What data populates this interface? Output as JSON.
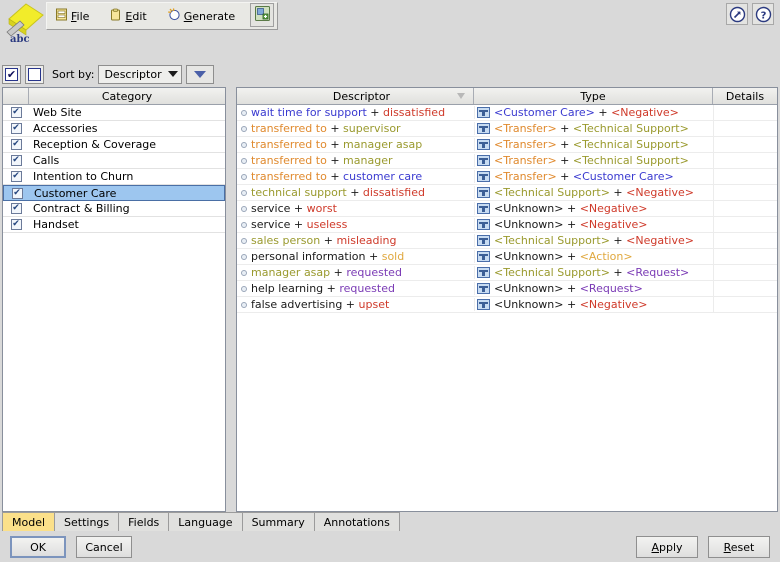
{
  "app": {
    "logo_text": "abc"
  },
  "menu": {
    "items": [
      {
        "label": "File",
        "mnemonic": "F",
        "icon": "file-cabinet-icon"
      },
      {
        "label": "Edit",
        "mnemonic": "E",
        "icon": "clipboard-icon"
      },
      {
        "label": "Generate",
        "mnemonic": "G",
        "icon": "magic-wand-icon"
      }
    ],
    "generate_button_icon": "generate-grid-icon"
  },
  "window_buttons": [
    {
      "name": "expand-button",
      "icon": "arrow-up-right-icon"
    },
    {
      "name": "help-button",
      "icon": "question-mark-icon"
    }
  ],
  "sortbar": {
    "check_all_label": "✔",
    "uncheck_all_label": "",
    "sort_by_label": "Sort by:",
    "sort_value": "Descriptor",
    "sort_options": [
      "Descriptor"
    ],
    "sort_direction_icon": "triangle-down-icon"
  },
  "category_panel": {
    "columns": [
      "",
      "Category"
    ],
    "rows": [
      {
        "checked": true,
        "name": "Web Site",
        "selected": false
      },
      {
        "checked": true,
        "name": "Accessories",
        "selected": false
      },
      {
        "checked": true,
        "name": "Reception & Coverage",
        "selected": false
      },
      {
        "checked": true,
        "name": "Calls",
        "selected": false
      },
      {
        "checked": true,
        "name": "Intention to Churn",
        "selected": false
      },
      {
        "checked": true,
        "name": "Customer Care",
        "selected": true
      },
      {
        "checked": true,
        "name": "Contract & Billing",
        "selected": false
      },
      {
        "checked": true,
        "name": "Handset",
        "selected": false
      }
    ]
  },
  "descriptor_panel": {
    "columns": [
      "Descriptor",
      "Type",
      "Details"
    ],
    "sorted_column": "Descriptor",
    "rows": [
      {
        "descriptor": [
          {
            "text": "wait time for support",
            "color": "#3a3ad0"
          },
          {
            "text": " + ",
            "color": "#1a1a1a"
          },
          {
            "text": "dissatisfied",
            "color": "#cf3a2a"
          }
        ],
        "type": [
          {
            "text": "<Customer Care>",
            "color": "#3a3ad0"
          },
          {
            "text": " + ",
            "color": "#1a1a1a"
          },
          {
            "text": "<Negative>",
            "color": "#cf3a2a"
          }
        ],
        "details": ""
      },
      {
        "descriptor": [
          {
            "text": "transferred to",
            "color": "#e08a2e"
          },
          {
            "text": " + ",
            "color": "#1a1a1a"
          },
          {
            "text": "supervisor",
            "color": "#9a9a2e"
          }
        ],
        "type": [
          {
            "text": "<Transfer>",
            "color": "#e08a2e"
          },
          {
            "text": " + ",
            "color": "#1a1a1a"
          },
          {
            "text": "<Technical Support>",
            "color": "#9a9a2e"
          }
        ],
        "details": ""
      },
      {
        "descriptor": [
          {
            "text": "transferred to",
            "color": "#e08a2e"
          },
          {
            "text": " + ",
            "color": "#1a1a1a"
          },
          {
            "text": "manager asap",
            "color": "#9a9a2e"
          }
        ],
        "type": [
          {
            "text": "<Transfer>",
            "color": "#e08a2e"
          },
          {
            "text": " + ",
            "color": "#1a1a1a"
          },
          {
            "text": "<Technical Support>",
            "color": "#9a9a2e"
          }
        ],
        "details": ""
      },
      {
        "descriptor": [
          {
            "text": "transferred to",
            "color": "#e08a2e"
          },
          {
            "text": " + ",
            "color": "#1a1a1a"
          },
          {
            "text": "manager",
            "color": "#9a9a2e"
          }
        ],
        "type": [
          {
            "text": "<Transfer>",
            "color": "#e08a2e"
          },
          {
            "text": " + ",
            "color": "#1a1a1a"
          },
          {
            "text": "<Technical Support>",
            "color": "#9a9a2e"
          }
        ],
        "details": ""
      },
      {
        "descriptor": [
          {
            "text": "transferred to",
            "color": "#e08a2e"
          },
          {
            "text": " + ",
            "color": "#1a1a1a"
          },
          {
            "text": "customer care",
            "color": "#3a3ad0"
          }
        ],
        "type": [
          {
            "text": "<Transfer>",
            "color": "#e08a2e"
          },
          {
            "text": " + ",
            "color": "#1a1a1a"
          },
          {
            "text": "<Customer Care>",
            "color": "#3a3ad0"
          }
        ],
        "details": ""
      },
      {
        "descriptor": [
          {
            "text": "technical support",
            "color": "#9a9a2e"
          },
          {
            "text": " + ",
            "color": "#1a1a1a"
          },
          {
            "text": "dissatisfied",
            "color": "#cf3a2a"
          }
        ],
        "type": [
          {
            "text": "<Technical Support>",
            "color": "#9a9a2e"
          },
          {
            "text": " + ",
            "color": "#1a1a1a"
          },
          {
            "text": "<Negative>",
            "color": "#cf3a2a"
          }
        ],
        "details": ""
      },
      {
        "descriptor": [
          {
            "text": "service",
            "color": "#1a1a1a"
          },
          {
            "text": " + ",
            "color": "#1a1a1a"
          },
          {
            "text": "worst",
            "color": "#cf3a2a"
          }
        ],
        "type": [
          {
            "text": "<Unknown>",
            "color": "#1a1a1a"
          },
          {
            "text": " + ",
            "color": "#1a1a1a"
          },
          {
            "text": "<Negative>",
            "color": "#cf3a2a"
          }
        ],
        "details": ""
      },
      {
        "descriptor": [
          {
            "text": "service",
            "color": "#1a1a1a"
          },
          {
            "text": " + ",
            "color": "#1a1a1a"
          },
          {
            "text": "useless",
            "color": "#cf3a2a"
          }
        ],
        "type": [
          {
            "text": "<Unknown>",
            "color": "#1a1a1a"
          },
          {
            "text": " + ",
            "color": "#1a1a1a"
          },
          {
            "text": "<Negative>",
            "color": "#cf3a2a"
          }
        ],
        "details": ""
      },
      {
        "descriptor": [
          {
            "text": "sales person",
            "color": "#9a9a2e"
          },
          {
            "text": " + ",
            "color": "#1a1a1a"
          },
          {
            "text": "misleading",
            "color": "#cf3a2a"
          }
        ],
        "type": [
          {
            "text": "<Technical Support>",
            "color": "#9a9a2e"
          },
          {
            "text": " + ",
            "color": "#1a1a1a"
          },
          {
            "text": "<Negative>",
            "color": "#cf3a2a"
          }
        ],
        "details": ""
      },
      {
        "descriptor": [
          {
            "text": "personal information",
            "color": "#1a1a1a"
          },
          {
            "text": " + ",
            "color": "#1a1a1a"
          },
          {
            "text": "sold",
            "color": "#e0a83e"
          }
        ],
        "type": [
          {
            "text": "<Unknown>",
            "color": "#1a1a1a"
          },
          {
            "text": " + ",
            "color": "#1a1a1a"
          },
          {
            "text": "<Action>",
            "color": "#e0a83e"
          }
        ],
        "details": ""
      },
      {
        "descriptor": [
          {
            "text": "manager asap",
            "color": "#9a9a2e"
          },
          {
            "text": " + ",
            "color": "#1a1a1a"
          },
          {
            "text": "requested",
            "color": "#7a3ab5"
          }
        ],
        "type": [
          {
            "text": "<Technical Support>",
            "color": "#9a9a2e"
          },
          {
            "text": " + ",
            "color": "#1a1a1a"
          },
          {
            "text": "<Request>",
            "color": "#7a3ab5"
          }
        ],
        "details": ""
      },
      {
        "descriptor": [
          {
            "text": "help learning",
            "color": "#1a1a1a"
          },
          {
            "text": " + ",
            "color": "#1a1a1a"
          },
          {
            "text": "requested",
            "color": "#7a3ab5"
          }
        ],
        "type": [
          {
            "text": "<Unknown>",
            "color": "#1a1a1a"
          },
          {
            "text": " + ",
            "color": "#1a1a1a"
          },
          {
            "text": "<Request>",
            "color": "#7a3ab5"
          }
        ],
        "details": ""
      },
      {
        "descriptor": [
          {
            "text": "false advertising",
            "color": "#1a1a1a"
          },
          {
            "text": " + ",
            "color": "#1a1a1a"
          },
          {
            "text": "upset",
            "color": "#cf3a2a"
          }
        ],
        "type": [
          {
            "text": "<Unknown>",
            "color": "#1a1a1a"
          },
          {
            "text": " + ",
            "color": "#1a1a1a"
          },
          {
            "text": "<Negative>",
            "color": "#cf3a2a"
          }
        ],
        "details": ""
      }
    ]
  },
  "tabs": [
    {
      "label": "Model",
      "active": true
    },
    {
      "label": "Settings",
      "active": false
    },
    {
      "label": "Fields",
      "active": false
    },
    {
      "label": "Language",
      "active": false
    },
    {
      "label": "Summary",
      "active": false
    },
    {
      "label": "Annotations",
      "active": false
    }
  ],
  "buttons": {
    "ok": "OK",
    "cancel": "Cancel",
    "apply": "Apply",
    "apply_mnemonic": "A",
    "reset": "Reset",
    "reset_mnemonic": "R"
  },
  "colors": {
    "selection": "#9dc6ef",
    "active_tab": "#fbe08a",
    "panel_bg": "#d9d9d9"
  }
}
